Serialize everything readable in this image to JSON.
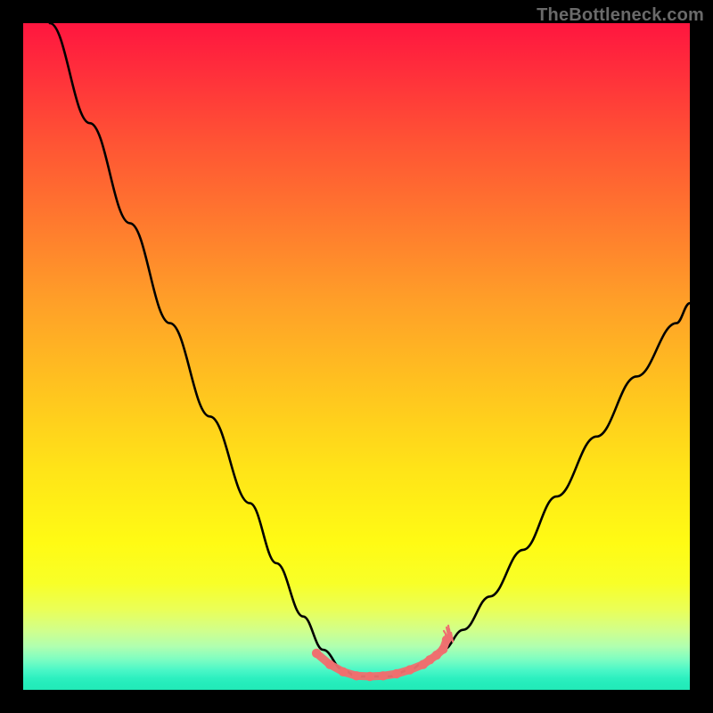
{
  "watermark": "TheBottleneck.com",
  "chart_data": {
    "type": "line",
    "title": "",
    "xlabel": "",
    "ylabel": "",
    "xlim": [
      0,
      100
    ],
    "ylim": [
      0,
      100
    ],
    "series": [
      {
        "name": "bottleneck-curve",
        "x": [
          4,
          10,
          16,
          22,
          28,
          34,
          38,
          42,
          45,
          48,
          50,
          52,
          55,
          58,
          60,
          63,
          66,
          70,
          75,
          80,
          86,
          92,
          98,
          100
        ],
        "values": [
          100,
          85,
          70,
          55,
          41,
          28,
          19,
          11,
          6,
          3,
          2,
          2,
          2,
          3,
          4,
          6,
          9,
          14,
          21,
          29,
          38,
          47,
          55,
          58
        ]
      }
    ],
    "markers": {
      "name": "peak-region",
      "x": [
        44,
        46,
        48,
        50,
        52,
        54,
        56,
        58,
        60,
        61,
        62,
        63,
        63.5
      ],
      "values": [
        5.5,
        3.8,
        2.7,
        2.1,
        2.0,
        2.1,
        2.4,
        3.0,
        3.8,
        4.5,
        5.2,
        6.1,
        7.5
      ]
    },
    "marker_splotch": {
      "name": "right-marker-splotch",
      "x": 63.5,
      "y": 7.5
    },
    "gradient_stops": [
      {
        "pos": 0.0,
        "color": "#ff163f"
      },
      {
        "pos": 0.3,
        "color": "#ff7a2e"
      },
      {
        "pos": 0.67,
        "color": "#ffe418"
      },
      {
        "pos": 0.88,
        "color": "#eaff58"
      },
      {
        "pos": 1.0,
        "color": "#22eab8"
      }
    ]
  }
}
